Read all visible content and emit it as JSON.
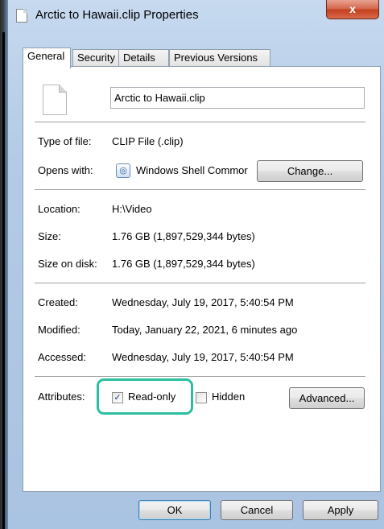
{
  "window": {
    "title": "Arctic to Hawaii.clip Properties",
    "close_label": "x"
  },
  "tabs": [
    {
      "label": "General",
      "active": true
    },
    {
      "label": "Security",
      "active": false
    },
    {
      "label": "Details",
      "active": false
    },
    {
      "label": "Previous Versions",
      "active": false
    }
  ],
  "general": {
    "file_name": "Arctic to Hawaii.clip",
    "type_label": "Type of file:",
    "type_value": "CLIP File (.clip)",
    "opens_label": "Opens with:",
    "opens_value": "Windows Shell Commor",
    "change_label": "Change...",
    "location_label": "Location:",
    "location_value": "H:\\Video",
    "size_label": "Size:",
    "size_value": "1.76 GB (1,897,529,344 bytes)",
    "size_disk_label": "Size on disk:",
    "size_disk_value": "1.76 GB (1,897,529,344 bytes)",
    "created_label": "Created:",
    "created_value": "Wednesday, July 19, 2017, 5:40:54 PM",
    "modified_label": "Modified:",
    "modified_value": "Today, January 22, 2021, 6 minutes ago",
    "accessed_label": "Accessed:",
    "accessed_value": "Wednesday, July 19, 2017, 5:40:54 PM",
    "attributes_label": "Attributes:",
    "readonly_label": "Read-only",
    "readonly_checked": true,
    "readonly_mark": "✓",
    "hidden_label": "Hidden",
    "hidden_checked": false,
    "advanced_label": "Advanced..."
  },
  "footer": {
    "ok_label": "OK",
    "cancel_label": "Cancel",
    "apply_label": "Apply"
  },
  "colors": {
    "highlight": "#2bbf9f",
    "titlebar": "#b3cbe6",
    "close": "#c4401f"
  },
  "icons": {
    "title": "document-icon",
    "file": "document-icon",
    "app": "shell-app-icon"
  }
}
